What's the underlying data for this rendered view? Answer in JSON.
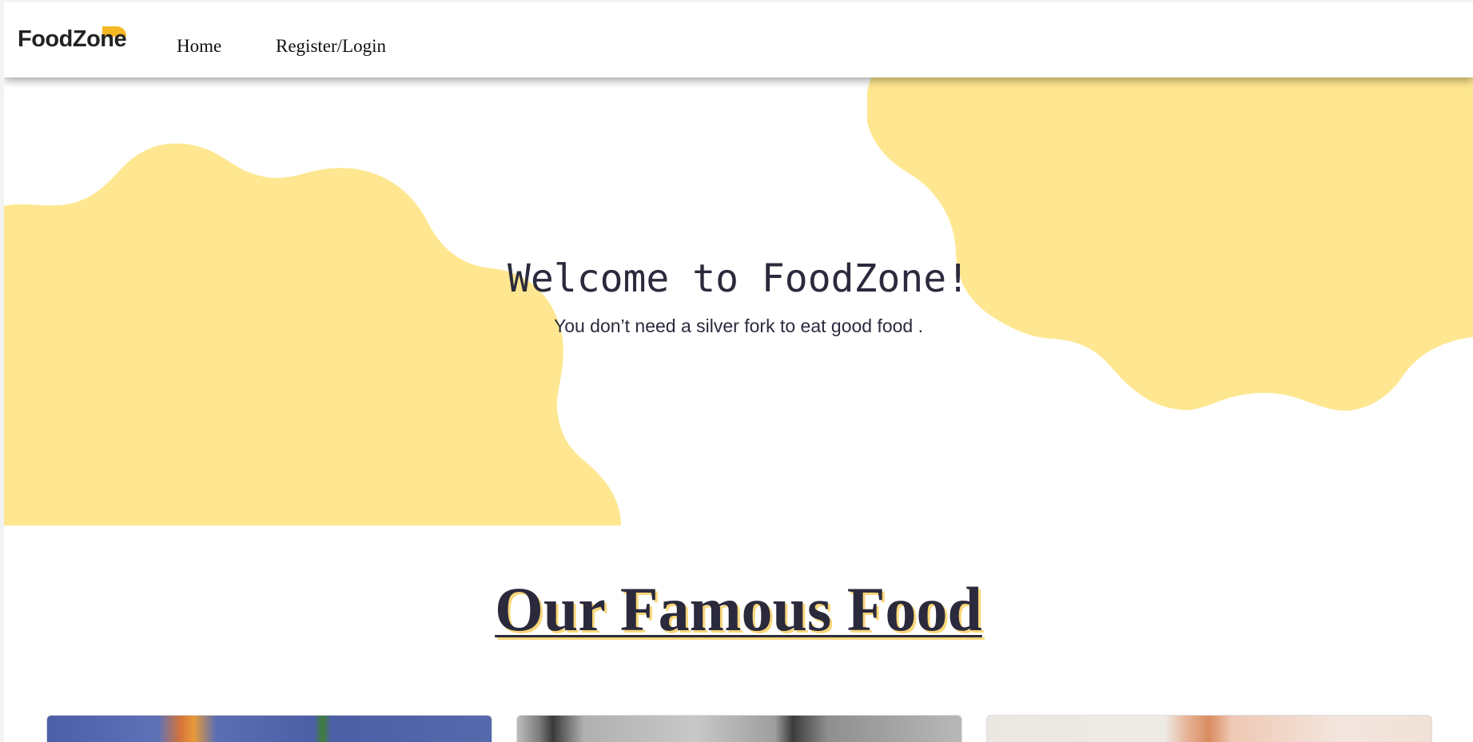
{
  "brand": {
    "name": "FoodZone",
    "accent_color": "#f5b823",
    "blob_color": "#fee790"
  },
  "nav": {
    "items": [
      {
        "label": "Home"
      },
      {
        "label": "Register/Login"
      }
    ]
  },
  "hero": {
    "title": "Welcome to FoodZone!",
    "subtitle": "You don’t need a silver fork to eat good food ."
  },
  "section": {
    "title": "Our Famous Food",
    "title_color": "#2b2a3d",
    "shadow_color": "#f8d77a"
  },
  "cards": [
    {
      "image": "food-photo-1"
    },
    {
      "image": "food-photo-2"
    },
    {
      "image": "food-photo-3"
    }
  ]
}
